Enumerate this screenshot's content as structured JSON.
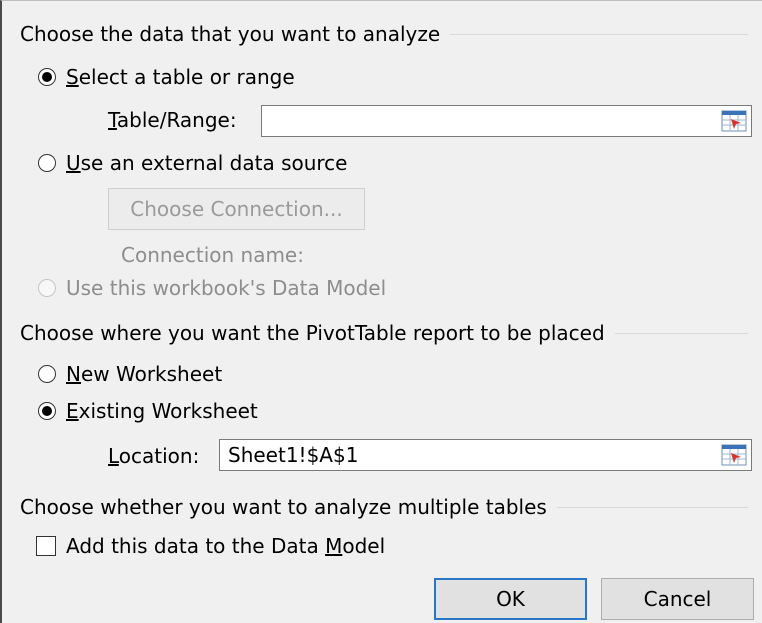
{
  "sections": {
    "analyze_data_label": "Choose the data that you want to analyze",
    "placement_label": "Choose where you want the PivotTable report to be placed",
    "multiple_tables_label": "Choose whether you want to analyze multiple tables"
  },
  "source": {
    "select_table": {
      "mnemonic": "S",
      "rest": "elect a table or range",
      "selected": true
    },
    "table_range": {
      "mnemonic": "T",
      "rest": "able/Range:",
      "value": ""
    },
    "external": {
      "mnemonic": "U",
      "rest": "se an external data source",
      "selected": false
    },
    "choose_connection_label": "Choose Connection...",
    "connection_name_label": "Connection name:",
    "data_model_option": "Use this workbook's Data Model"
  },
  "placement": {
    "new_worksheet": {
      "mnemonic": "N",
      "rest": "ew Worksheet",
      "selected": false
    },
    "existing_worksheet": {
      "mnemonic": "E",
      "rest": "xisting Worksheet",
      "selected": true
    },
    "location": {
      "mnemonic": "L",
      "rest": "ocation:",
      "value": "Sheet1!$A$1"
    }
  },
  "data_model_checkbox": {
    "before": "Add this data to the Data ",
    "mnemonic": "M",
    "after": "odel",
    "checked": false
  },
  "buttons": {
    "ok": "OK",
    "cancel": "Cancel"
  },
  "colors": {
    "default_button_border": "#2a76c6",
    "disabled_text": "#8d8d8d"
  },
  "icons": {
    "range_selector": "collapse-dialog-icon"
  }
}
